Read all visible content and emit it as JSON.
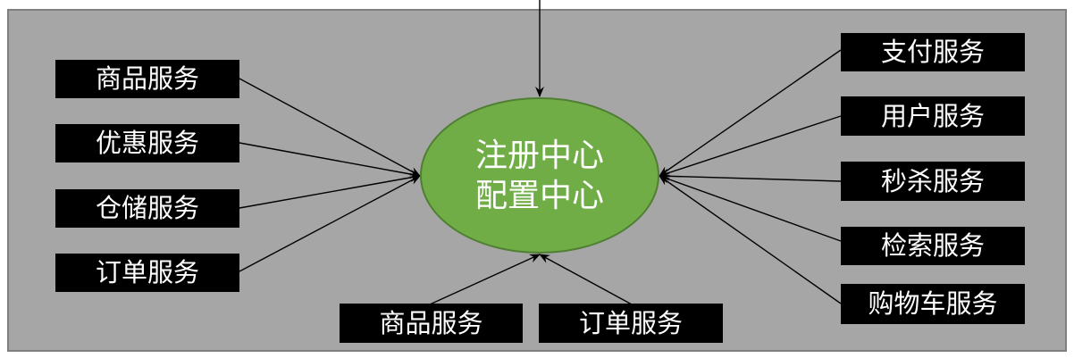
{
  "hub": {
    "line1": "注册中心",
    "line2": "配置中心",
    "color": "#70ad47"
  },
  "left_services": [
    "商品服务",
    "优惠服务",
    "仓储服务",
    "订单服务"
  ],
  "right_services": [
    "支付服务",
    "用户服务",
    "秒杀服务",
    "检索服务",
    "购物车服务"
  ],
  "bottom_services": [
    "商品服务",
    "订单服务"
  ],
  "colors": {
    "background_panel": "#a6a6a6",
    "service_box": "#000000",
    "text": "#ffffff"
  }
}
